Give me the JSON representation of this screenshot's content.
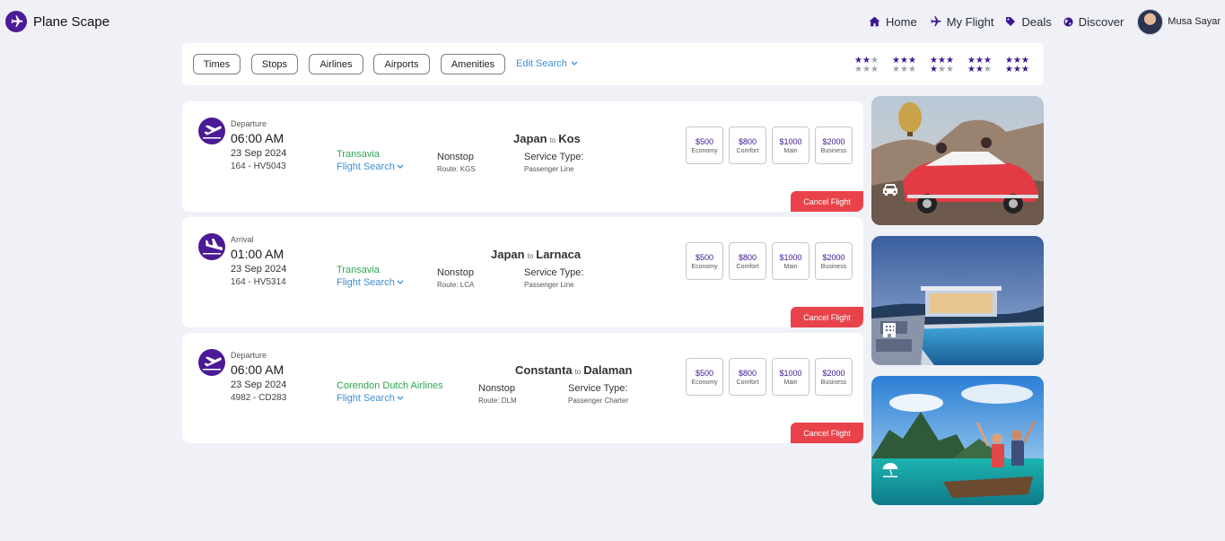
{
  "brand": {
    "name": "Plane Scape",
    "icon": "airplane-icon",
    "color": "#4b1a96"
  },
  "nav": [
    {
      "label": "Home",
      "icon": "home-icon"
    },
    {
      "label": "My Flight",
      "icon": "airplane-icon"
    },
    {
      "label": "Deals",
      "icon": "tag-icon"
    },
    {
      "label": "Discover",
      "icon": "globe-icon"
    }
  ],
  "user": {
    "name": "Musa Sayar"
  },
  "filters": {
    "chips": [
      "Times",
      "Stops",
      "Airlines",
      "Airports",
      "Amenities"
    ],
    "edit_search": "Edit Search",
    "ratings": [
      1,
      2,
      3,
      4,
      5
    ]
  },
  "flights": [
    {
      "direction": "Departure",
      "time": "06:00 AM",
      "date": "23 Sep 2024",
      "flight_no": "164 - HV5043",
      "airline": "Transavia",
      "flight_search": "Flight Search",
      "stops": "Nonstop",
      "route": "Route: KGS",
      "from": "Japan",
      "to_word": "to",
      "to": "Kos",
      "service_label": "Service Type:",
      "service_type": "Passenger Line",
      "prices": [
        {
          "value": "$500",
          "class": "Economy"
        },
        {
          "value": "$800",
          "class": "Comfort"
        },
        {
          "value": "$1000",
          "class": "Main"
        },
        {
          "value": "$2000",
          "class": "Business"
        }
      ],
      "cancel": "Cancel Flight"
    },
    {
      "direction": "Arrival",
      "time": "01:00 AM",
      "date": "23 Sep 2024",
      "flight_no": "164 - HV5314",
      "airline": "Transavia",
      "flight_search": "Flight Search",
      "stops": "Nonstop",
      "route": "Route: LCA",
      "from": "Japan",
      "to_word": "to",
      "to": "Larnaca",
      "service_label": "Service Type:",
      "service_type": "Passenger Line",
      "prices": [
        {
          "value": "$500",
          "class": "Economy"
        },
        {
          "value": "$800",
          "class": "Comfort"
        },
        {
          "value": "$1000",
          "class": "Main"
        },
        {
          "value": "$2000",
          "class": "Business"
        }
      ],
      "cancel": "Cancel Flight"
    },
    {
      "direction": "Departure",
      "time": "06:00 AM",
      "date": "23 Sep 2024",
      "flight_no": "4982 - CD283",
      "airline": "Corendon Dutch Airlines",
      "flight_search": "Flight Search",
      "stops": "Nonstop",
      "route": "Route: DLM",
      "from": "Constanta",
      "to_word": "to",
      "to": "Dalaman",
      "service_label": "Service Type:",
      "service_type": "Passenger Charter",
      "prices": [
        {
          "value": "$500",
          "class": "Economy"
        },
        {
          "value": "$800",
          "class": "Comfort"
        },
        {
          "value": "$1000",
          "class": "Main"
        },
        {
          "value": "$2000",
          "class": "Business"
        }
      ],
      "cancel": "Cancel Flight"
    }
  ],
  "side_cards": [
    {
      "icon": "car-icon"
    },
    {
      "icon": "hotel-icon"
    },
    {
      "icon": "beach-umbrella-icon"
    }
  ],
  "colors": {
    "accent": "#4b1a96",
    "cancel": "#e8434a",
    "airline_green": "#2ea551",
    "link_blue": "#3d8fd6"
  }
}
